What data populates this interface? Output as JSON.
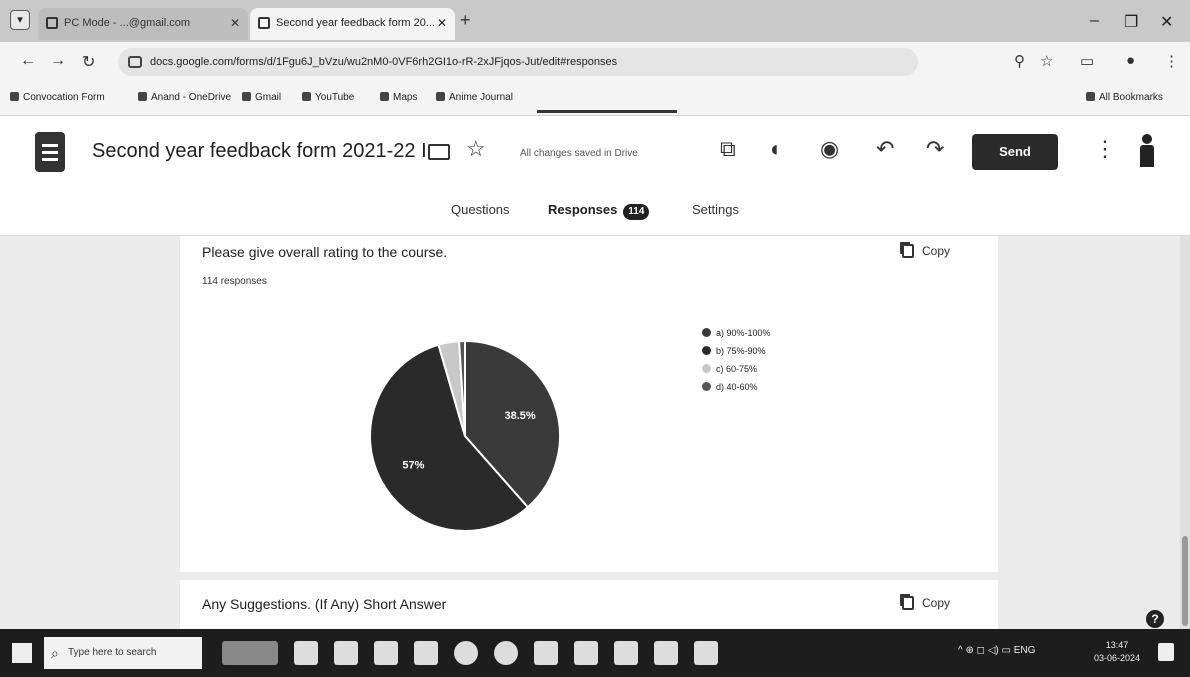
{
  "browser": {
    "tabs": [
      {
        "title": "PC Mode - ...@gmail.com",
        "active": false
      },
      {
        "title": "Second year feedback form 20...",
        "active": true
      }
    ],
    "url": "docs.google.com/forms/d/1Fgu6J_bVzu/wu2nM0-0VF6rh2GI1o-rR-2xJFjqos-Jut/edit#responses",
    "bookmarks": [
      "Convocation Form",
      "Anand - OneDrive",
      "Gmail",
      "YouTube",
      "Maps",
      "Anime Journal"
    ],
    "all_bookmarks_label": "All Bookmarks"
  },
  "form": {
    "title": "Second year feedback form 2021-22 I",
    "save_status": "All changes saved in Drive",
    "send_label": "Send",
    "tabs": {
      "questions": "Questions",
      "responses": "Responses",
      "responses_count": "114",
      "settings": "Settings"
    }
  },
  "question1": {
    "title": "Please give overall rating to the course.",
    "responses_text": "114 responses",
    "copy_label": "Copy"
  },
  "chart_data": {
    "type": "pie",
    "title": "Please give overall rating to the course.",
    "labels": [
      "a) 90%-100%",
      "b) 75%-90%",
      "c) 60-75%",
      "d) 40-60%"
    ],
    "values": [
      38.5,
      57,
      3.5,
      1
    ],
    "data_labels": [
      "38.5%",
      "57%",
      "",
      ""
    ],
    "colors": [
      "#3a3a3a",
      "#2a2a2a",
      "#c8c8c8",
      "#555555"
    ],
    "legend_position": "right"
  },
  "question2": {
    "title": "Any Suggestions. (If Any) Short Answer",
    "copy_label": "Copy"
  },
  "taskbar": {
    "search_placeholder": "Type here to search",
    "tray_text": "^ ⊕ ◻ ◁) ▭ ENG",
    "time": "13:47",
    "date": "03-06-2024"
  }
}
